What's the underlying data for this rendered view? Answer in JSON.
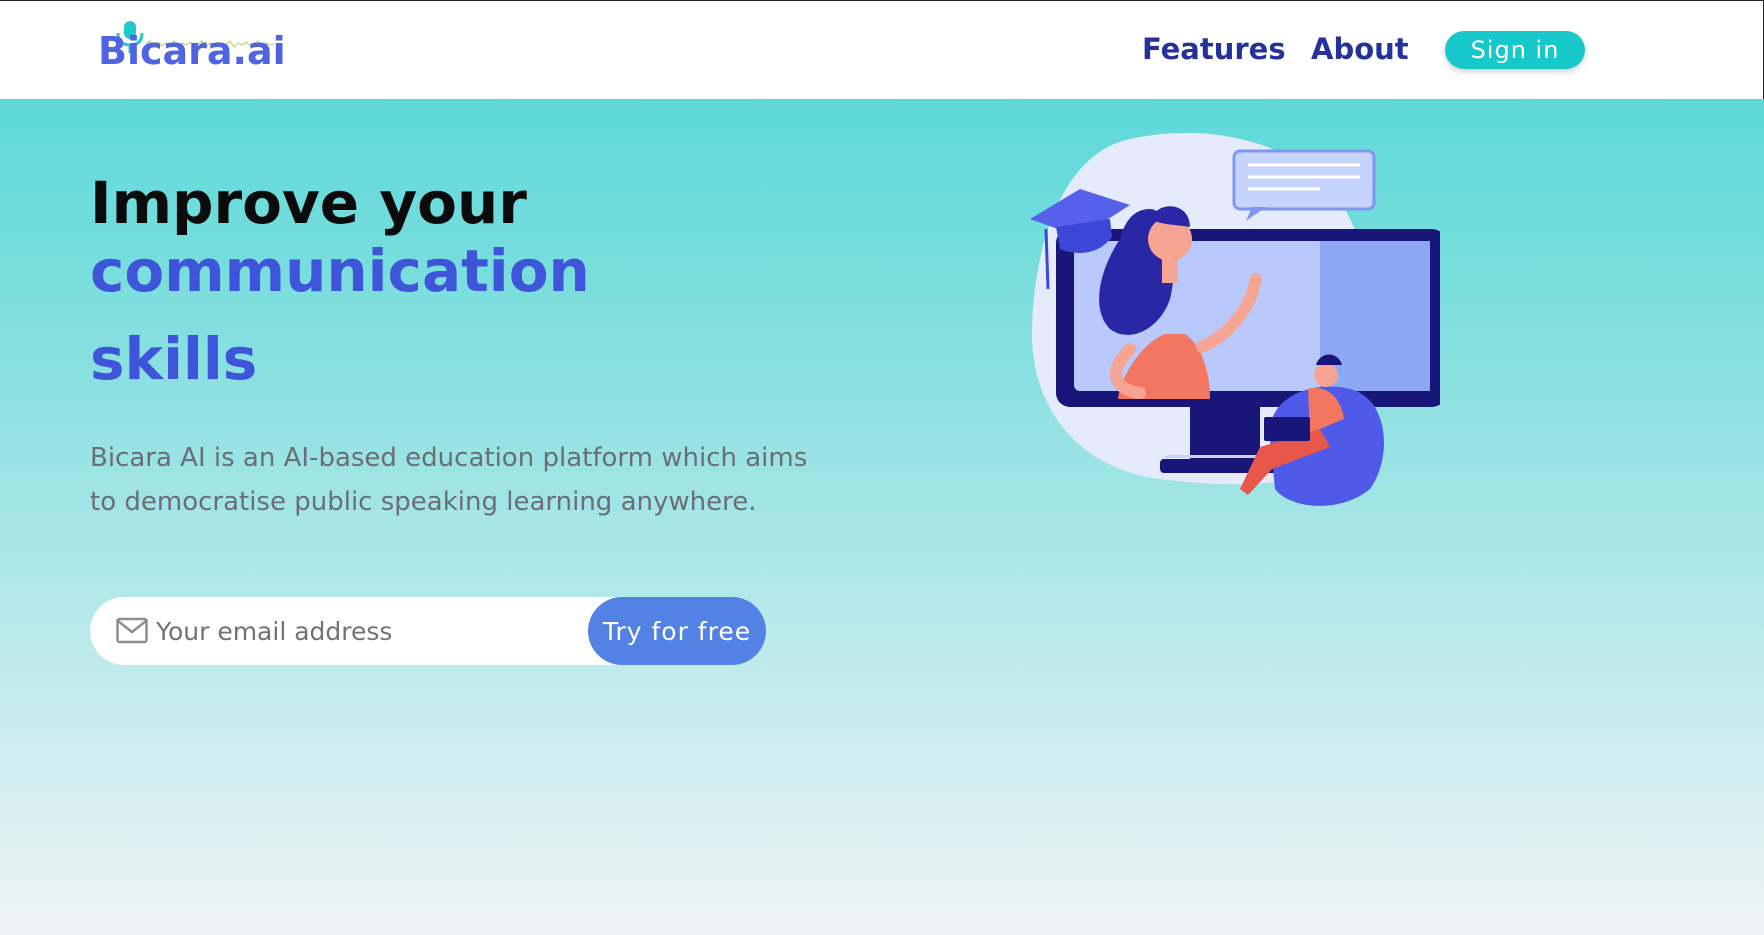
{
  "header": {
    "logo_text": "Bicara.ai",
    "nav": {
      "features_label": "Features",
      "about_label": "About"
    },
    "signin_label": "Sign in"
  },
  "hero": {
    "headline_line1": "Improve your",
    "headline_line2": "communication",
    "headline_line3": "skills",
    "description": "Bicara AI is an AI-based education platform which aims to democratise public speaking learning anywhere.",
    "email_placeholder": "Your email address",
    "cta_label": "Try for free"
  },
  "colors": {
    "brand_blue": "#3f55d9",
    "nav_navy": "#26329b",
    "signin_teal": "#17c8cb",
    "cta_blue": "#5282e4",
    "hero_top": "#5cd9d8",
    "hero_bottom": "#eef3f6"
  },
  "icons": {
    "logo_mic": "microphone-icon",
    "email": "mail-icon"
  }
}
